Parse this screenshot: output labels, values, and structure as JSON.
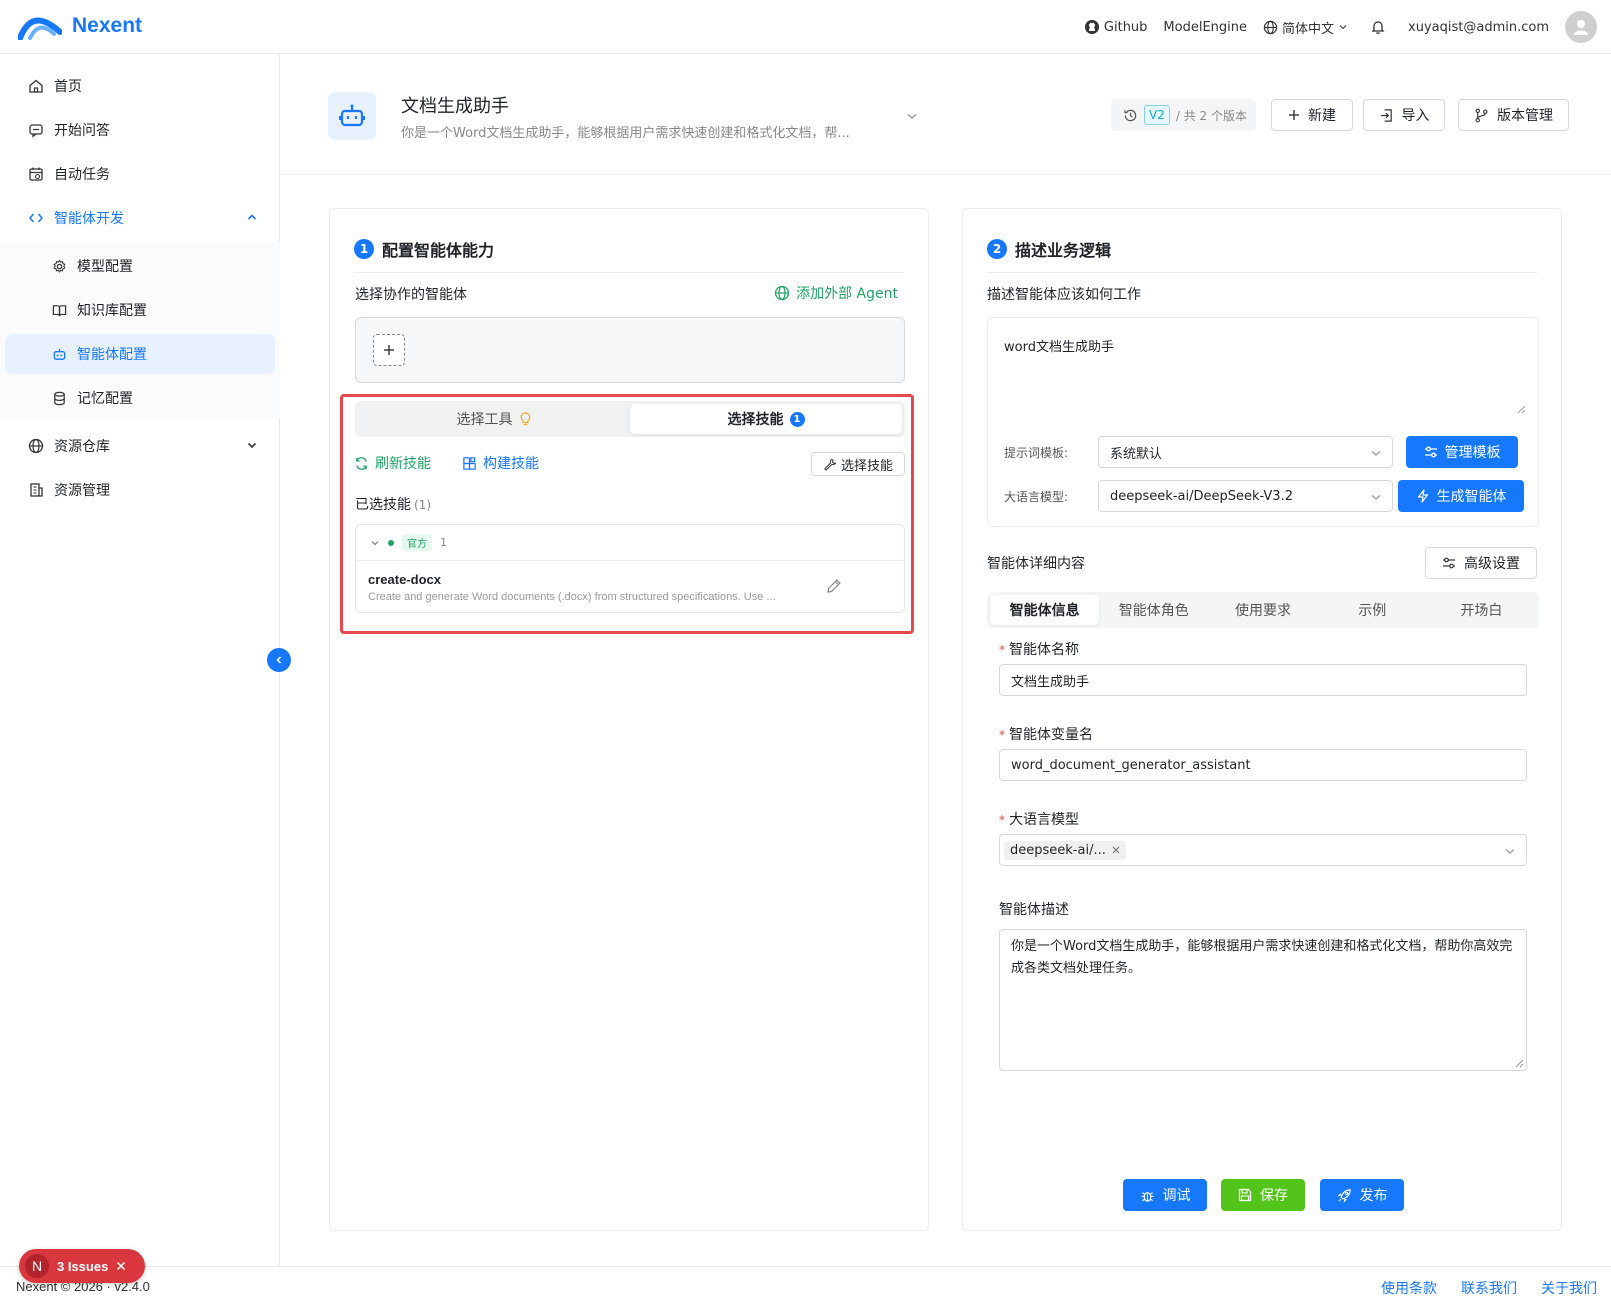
{
  "header": {
    "logo_text": "Nexent",
    "links": [
      "Github",
      "ModelEngine"
    ],
    "language": "简体中文",
    "user_email": "xuyaqist@admin.com"
  },
  "sidebar": {
    "items": [
      {
        "label": "首页",
        "icon": "home-icon"
      },
      {
        "label": "开始问答",
        "icon": "chat-icon"
      },
      {
        "label": "自动任务",
        "icon": "calendar-icon"
      },
      {
        "label": "智能体开发",
        "icon": "code-icon",
        "expanded": true
      },
      {
        "label": "资源仓库",
        "icon": "globe-icon"
      },
      {
        "label": "资源管理",
        "icon": "building-icon"
      }
    ],
    "sub_items": [
      {
        "label": "模型配置",
        "icon": "gear-icon"
      },
      {
        "label": "知识库配置",
        "icon": "book-icon"
      },
      {
        "label": "智能体配置",
        "icon": "robot-icon",
        "active": true
      },
      {
        "label": "记忆配置",
        "icon": "database-icon"
      }
    ]
  },
  "titlebar": {
    "agent_name": "文档生成助手",
    "agent_desc": "你是一个Word文档生成助手，能够根据用户需求快速创建和格式化文档，帮...",
    "version_tag": "V2",
    "version_total": "/ 共 2 个版本",
    "new_label": "新建",
    "import_label": "导入",
    "version_mgmt_label": "版本管理"
  },
  "left_panel": {
    "step": "1",
    "title": "配置智能体能力",
    "collab_label": "选择协作的智能体",
    "add_external": "添加外部 Agent",
    "tab_tools": "选择工具",
    "tab_skills": "选择技能",
    "skills_badge": "1",
    "refresh_skills": "刷新技能",
    "build_skills": "构建技能",
    "select_skills_btn": "选择技能",
    "selected_label": "已选技能",
    "selected_count": "(1)",
    "group_tag": "官方",
    "group_count": "1",
    "skill_name": "create-docx",
    "skill_desc": "Create and generate Word documents (.docx) from structured specifications. Use ..."
  },
  "right_panel": {
    "step": "2",
    "title": "描述业务逻辑",
    "desc_label": "描述智能体应该如何工作",
    "desc_value": "word文档生成助手",
    "prompt_tpl_label": "提示词模板:",
    "prompt_tpl_value": "系统默认",
    "manage_tpl_btn": "管理模板",
    "llm_label": "大语言模型:",
    "llm_value": "deepseek-ai/DeepSeek-V3.2",
    "generate_btn": "生成智能体",
    "detail_label": "智能体详细内容",
    "advanced_btn": "高级设置",
    "tabs": [
      "智能体信息",
      "智能体角色",
      "使用要求",
      "示例",
      "开场白"
    ],
    "fields": {
      "name_label": "智能体名称",
      "name_value": "文档生成助手",
      "var_label": "智能体变量名",
      "var_value": "word_document_generator_assistant",
      "model_label": "大语言模型",
      "model_chip": "deepseek-ai/...",
      "desc_label": "智能体描述",
      "desc_value": "你是一个Word文档生成助手，能够根据用户需求快速创建和格式化文档，帮助你高效完成各类文档处理任务。"
    },
    "debug_btn": "调试",
    "save_btn": "保存",
    "publish_btn": "发布"
  },
  "footer": {
    "copyright": "Nexent © 2026 · v2.4.0",
    "links": [
      "使用条款",
      "联系我们",
      "关于我们"
    ]
  },
  "issues": {
    "letter": "N",
    "label": "3 Issues"
  },
  "colors": {
    "primary": "#1677ff",
    "success": "#21a366",
    "save": "#52c41a",
    "danger": "#e5484d"
  }
}
